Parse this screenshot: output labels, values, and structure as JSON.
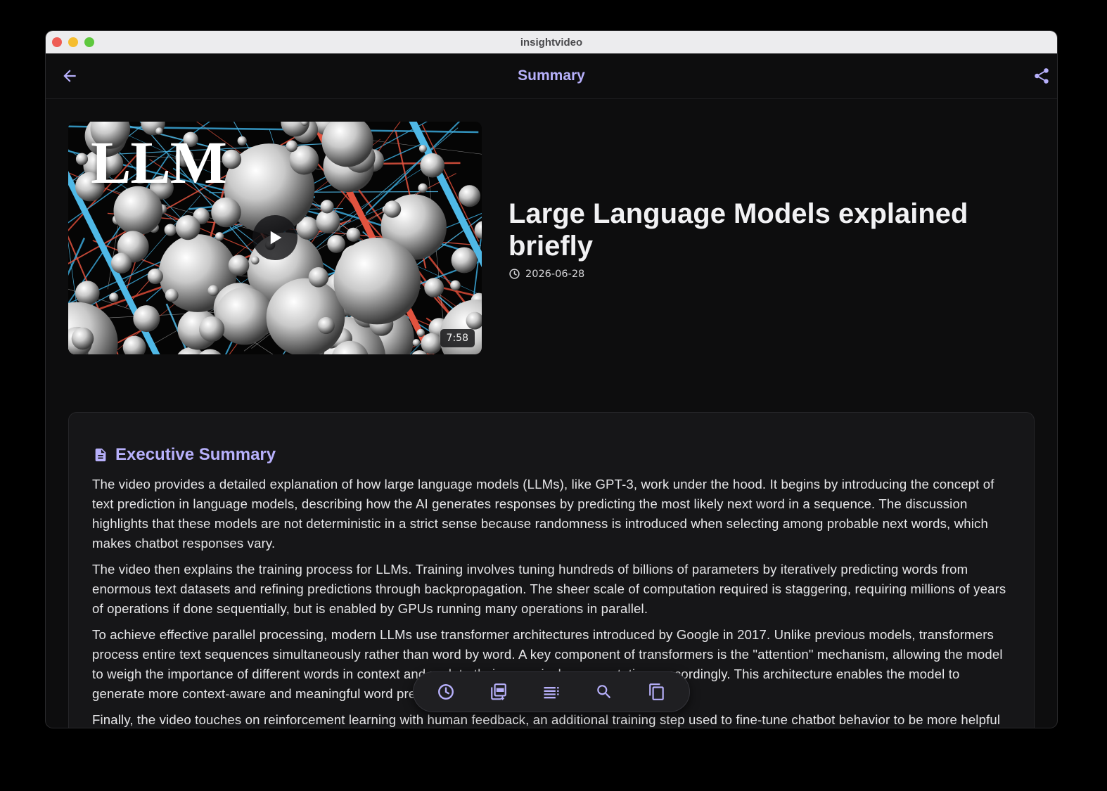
{
  "window": {
    "title": "insightvideo"
  },
  "appbar": {
    "title": "Summary",
    "back_icon": "arrow-left-icon",
    "share_icon": "share-icon"
  },
  "video": {
    "thumbnail_text": "LLM",
    "duration": "7:58",
    "title": "Large Language Models explained briefly",
    "date": "2026-06-28"
  },
  "summary": {
    "title": "Executive Summary",
    "icon": "document-icon",
    "paragraphs": [
      "The video provides a detailed explanation of how large language models (LLMs), like GPT-3, work under the hood. It begins by introducing the concept of text prediction in language models, describing how the AI generates responses by predicting the most likely next word in a sequence. The discussion highlights that these models are not deterministic in a strict sense because randomness is introduced when selecting among probable next words, which makes chatbot responses vary.",
      "The video then explains the training process for LLMs. Training involves tuning hundreds of billions of parameters by iteratively predicting words from enormous text datasets and refining predictions through backpropagation. The sheer scale of computation required is staggering, requiring millions of years of operations if done sequentially, but is enabled by GPUs running many operations in parallel.",
      "To achieve effective parallel processing, modern LLMs use transformer architectures introduced by Google in 2017. Unlike previous models, transformers process entire text sequences simultaneously rather than word by word. A key component of transformers is the \"attention\" mechanism, allowing the model to weigh the importance of different words in context and update their numerical representations accordingly. This architecture enables the model to generate more context-aware and meaningful word predictions.",
      "Finally, the video touches on reinforcement learning with human feedback, an additional training step used to fine-tune chatbot behavior to be more helpful and avoid problematic responses. It also points viewers to further resources for deeper understanding of transformers and attention mechanisms."
    ]
  },
  "toolbar": {
    "items": [
      "clock-icon",
      "pdf-export-icon",
      "list-icon",
      "search-icon",
      "copy-icon"
    ]
  },
  "colors": {
    "accent": "#b7b0fb",
    "background": "#0d0d0e",
    "card": "#161618",
    "text": "#e6e6e8"
  }
}
